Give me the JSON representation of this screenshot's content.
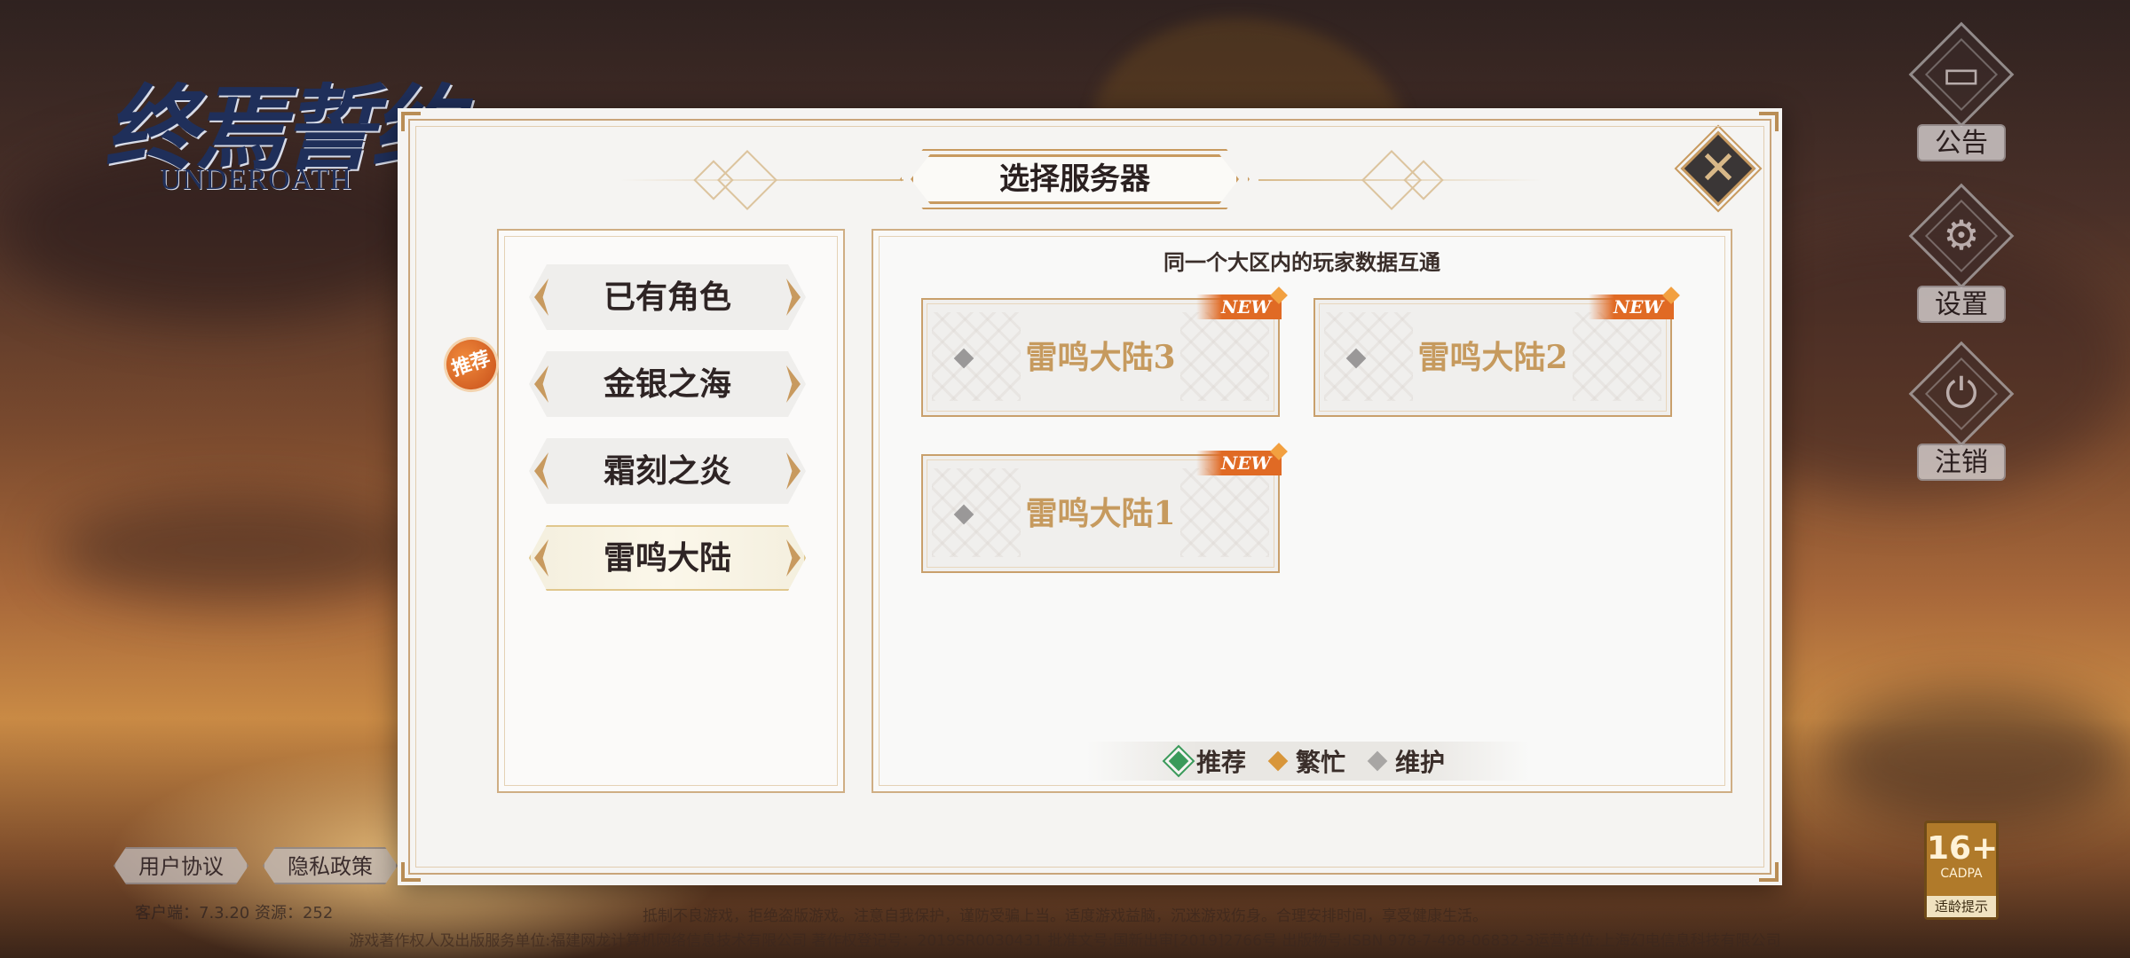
{
  "logo": {
    "title": "终焉誓约",
    "subtitle": "UNDEROATH"
  },
  "side_buttons": [
    {
      "icon": "announcement-icon",
      "glyph": "▭",
      "label": "公告"
    },
    {
      "icon": "gear-icon",
      "glyph": "⚙",
      "label": "设置"
    },
    {
      "icon": "power-icon",
      "glyph": "⏻",
      "label": "注销"
    }
  ],
  "links": {
    "user_agreement": "用户协议",
    "privacy_policy": "隐私政策"
  },
  "version_text": "客户端：7.3.20  资源：252",
  "footer": {
    "line1": "抵制不良游戏，拒绝盗版游戏。注意自我保护，谨防受骗上当。适度游戏益脑，沉迷游戏伤身。合理安排时间，享受健康生活。",
    "line2": "游戏著作权人及出版服务单位:福建网龙计算机网络信息技术有限公司  著作权登记号：2019SR0030431  批准文号:国新出审[2019]2766号  出版物号:ISBN 978-7-498-06832-3运营单位:上海幻电信息科技有限公司"
  },
  "age_rating": {
    "age": "16+",
    "org": "CADPA",
    "tip": "适龄提示"
  },
  "dialog": {
    "title": "选择服务器",
    "close_icon": "close-icon",
    "regions": [
      {
        "label": "已有角色",
        "selected": false,
        "recommended": false
      },
      {
        "label": "金银之海",
        "selected": false,
        "recommended": true
      },
      {
        "label": "霜刻之炎",
        "selected": false,
        "recommended": false
      },
      {
        "label": "雷鸣大陆",
        "selected": true,
        "recommended": false
      }
    ],
    "recommended_badge": "推荐",
    "hint": "同一个大区内的玩家数据互通",
    "servers": [
      {
        "name": "雷鸣大陆3",
        "tag": "NEW",
        "status": "maintenance"
      },
      {
        "name": "雷鸣大陆2",
        "tag": "NEW",
        "status": "maintenance"
      },
      {
        "name": "雷鸣大陆1",
        "tag": "NEW",
        "status": "maintenance"
      }
    ],
    "legend": [
      {
        "label": "推荐",
        "color": "#3a9a5a"
      },
      {
        "label": "繁忙",
        "color": "#d8963a"
      },
      {
        "label": "维护",
        "color": "#a8a6a4"
      }
    ]
  }
}
